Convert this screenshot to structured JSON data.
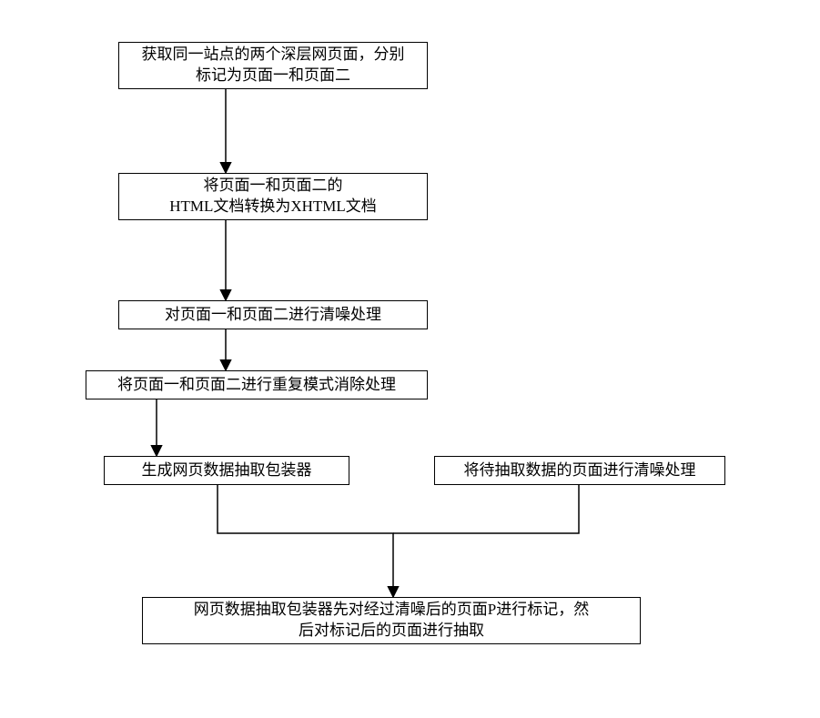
{
  "flow": {
    "nodes": {
      "n1": "获取同一站点的两个深层网页面，分别\n标记为页面一和页面二",
      "n2": "将页面一和页面二的\nHTML文档转换为XHTML文档",
      "n3": "对页面一和页面二进行清噪处理",
      "n4": "将页面一和页面二进行重复模式消除处理",
      "n5": "生成网页数据抽取包装器",
      "n6": "将待抽取数据的页面进行清噪处理",
      "n7": "网页数据抽取包装器先对经过清噪后的页面P进行标记，然\n后对标记后的页面进行抽取"
    },
    "edges": [
      {
        "from": "n1",
        "to": "n2"
      },
      {
        "from": "n2",
        "to": "n3"
      },
      {
        "from": "n3",
        "to": "n4"
      },
      {
        "from": "n4",
        "to": "n5"
      },
      {
        "from": "n5",
        "to": "n7"
      },
      {
        "from": "n6",
        "to": "n7"
      }
    ]
  }
}
